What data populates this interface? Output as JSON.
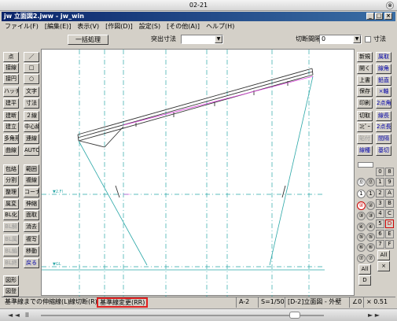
{
  "outer": {
    "title": "02-21",
    "close_label": "⊗"
  },
  "window": {
    "title": "jw 立面図2.jww - jw_win",
    "min": "_",
    "max": "□",
    "close": "×"
  },
  "menu": [
    "ファイル(F)",
    "[編集(E)]",
    "表示(V)",
    "[作図(D)]",
    "設定(S)",
    "[その他(A)]",
    "ヘルプ(H)"
  ],
  "toolbar": {
    "batch_button": "一括処理",
    "protrusion_label": "突出寸法",
    "protrusion_value": "",
    "cut_interval_label": "切断間隔",
    "cut_interval_value": "0",
    "dimension_label": "寸法"
  },
  "left_tools": [
    [
      "点",
      "／"
    ],
    [
      "接線",
      "□"
    ],
    [
      "接円",
      "○"
    ],
    [
      "ハッチ",
      "文字"
    ],
    [
      "建平",
      "寸法"
    ],
    [
      "建断",
      "２線"
    ],
    [
      "建立",
      "中心線"
    ],
    [
      "多角形",
      "連線"
    ],
    [
      "曲線",
      "AUTO"
    ],
    [
      "包絡",
      "範囲"
    ],
    [
      "分割",
      "複線"
    ],
    [
      "整理",
      "コーナー"
    ],
    [
      "属変",
      "伸縮"
    ],
    [
      "BL化",
      "面取"
    ],
    [
      "BL解",
      "消去"
    ],
    [
      "BL属",
      "複写"
    ],
    [
      "BL編",
      "移動"
    ],
    [
      "BL終",
      "戻る"
    ],
    [
      "図形",
      ""
    ],
    [
      "図登",
      ""
    ]
  ],
  "right_tools": [
    [
      "新規",
      "属取"
    ],
    [
      "開く",
      "線角"
    ],
    [
      "上書",
      "鉛直"
    ],
    [
      "保存",
      "×軸"
    ],
    [
      "印刷",
      "2点角"
    ],
    [
      "切取",
      "線長"
    ],
    [
      "ｺﾋﾟｰ",
      "2点長"
    ],
    [
      "貼付",
      "間隔"
    ],
    [
      "線種",
      "基切"
    ]
  ],
  "layers": {
    "group_rows": [
      [
        "⓪",
        "0"
      ],
      [
        "1",
        "1"
      ],
      [
        "②",
        "2"
      ],
      [
        "③",
        "3"
      ],
      [
        "④",
        "4"
      ],
      [
        "⑤",
        "5"
      ],
      [
        "⑥",
        "6"
      ],
      [
        "⑦",
        "7"
      ],
      [
        "All",
        "All"
      ],
      [
        "D",
        "D"
      ]
    ],
    "layer_rows": [
      [
        "0",
        "8"
      ],
      [
        "1",
        "9"
      ],
      [
        "2",
        "A"
      ],
      [
        "3",
        "B"
      ],
      [
        "4",
        "C"
      ],
      [
        "5",
        "D"
      ],
      [
        "6",
        "E"
      ],
      [
        "7",
        "F"
      ]
    ],
    "all_label": "All",
    "x_label": "×"
  },
  "status": {
    "message_1": "基準線までの伸縮線(L)",
    "message_2": "線切断(R)",
    "message_3": "基準線変更(RR)",
    "paper": "A-2",
    "scale": "S=1/50",
    "layer": "[D-2]立面図 - 外壁",
    "angle": "∠0",
    "zoom": "× 0.51"
  },
  "canvas_labels": {
    "gl_top": "▼2.Fl",
    "gl_bottom": "▼GL"
  },
  "bottom": {
    "left_arrows": "◄ ◄",
    "pause": "II",
    "right_arrows": "► ►"
  }
}
